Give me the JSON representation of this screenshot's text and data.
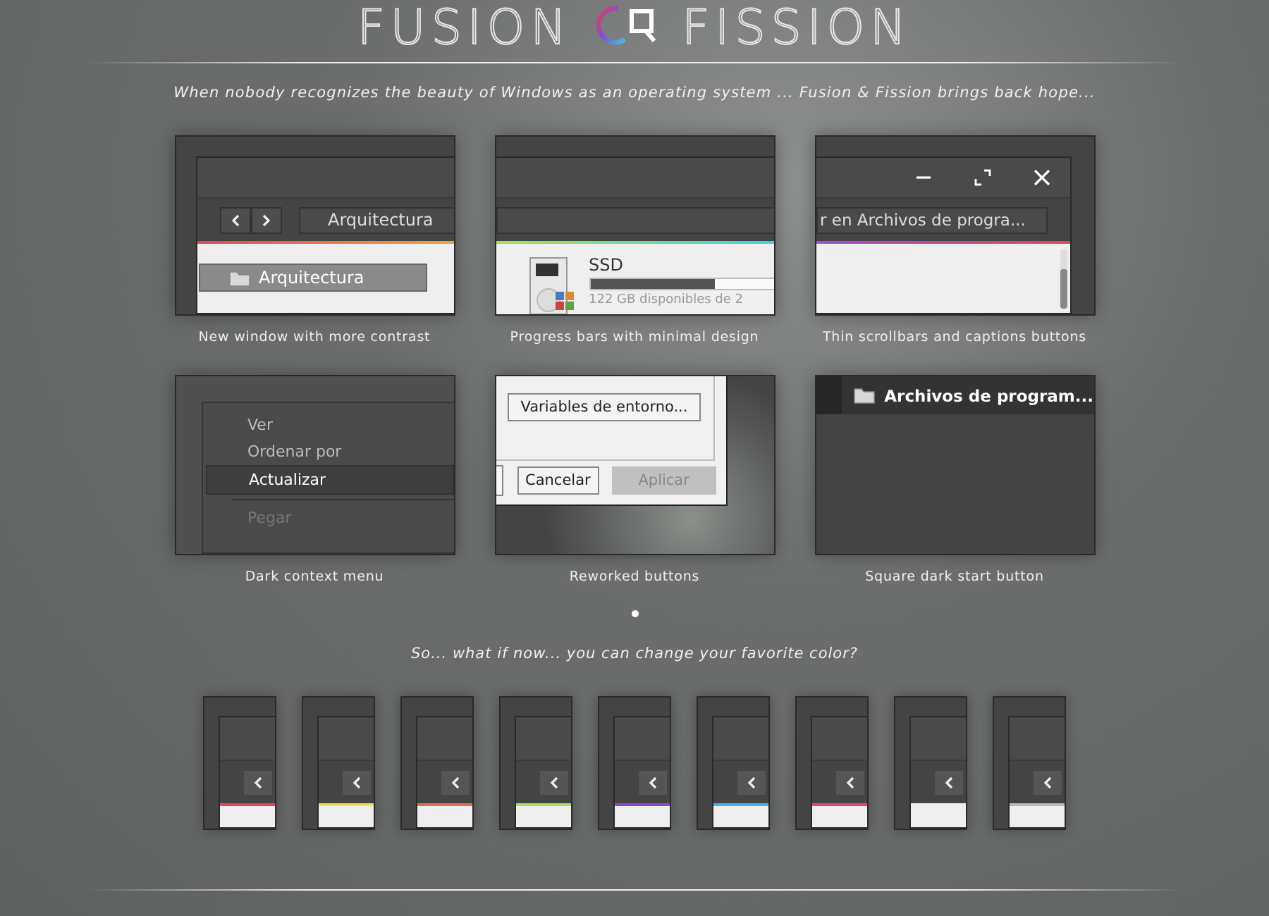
{
  "header": {
    "title_left": "FUSION",
    "title_right": "FISSION",
    "tagline": "When nobody recognizes the beauty of Windows as an operating system ... Fusion & Fission brings back hope..."
  },
  "features": [
    {
      "kind": "nav",
      "caption": "New window with more contrast",
      "address": "Arquitectura",
      "folder": "Arquitectura"
    },
    {
      "kind": "progress",
      "caption": "Progress bars with minimal design",
      "drive": "SSD",
      "level": 0.68,
      "detail": "122 GB disponibles de 2"
    },
    {
      "kind": "captions",
      "caption": "Thin scrollbars and captions buttons",
      "search": "r en Archivos de progra..."
    },
    {
      "kind": "menu",
      "caption": "Dark context menu",
      "items": [
        {
          "label": "Ver",
          "selected": false,
          "disabled": false
        },
        {
          "label": "Ordenar por",
          "selected": false,
          "disabled": false
        },
        {
          "label": "Actualizar",
          "selected": true,
          "disabled": false
        },
        {
          "label": "Pegar",
          "selected": false,
          "disabled": true
        }
      ]
    },
    {
      "kind": "buttons",
      "caption": "Reworked buttons",
      "buttons": [
        {
          "label": "Variables de entorno...",
          "disabled": false
        },
        {
          "label": "Cancelar",
          "disabled": false
        },
        {
          "label": "Aplicar",
          "disabled": true
        }
      ]
    },
    {
      "kind": "start",
      "caption": "Square dark start button",
      "folder": "Archivos de program..."
    }
  ],
  "pager": [
    {
      "selected": true
    }
  ],
  "question": "So... what if now... you can change your favorite color?",
  "swatches": [
    {
      "color": "#e0485a"
    },
    {
      "color": "#f2e04a"
    },
    {
      "color": "#e0704a"
    },
    {
      "color": "#a8e050"
    },
    {
      "color": "#8a4ad0"
    },
    {
      "color": "#4ab0f0"
    },
    {
      "color": "#e04870"
    },
    {
      "color": "#f0f0f0"
    },
    {
      "color": "#b8b8b8"
    }
  ]
}
